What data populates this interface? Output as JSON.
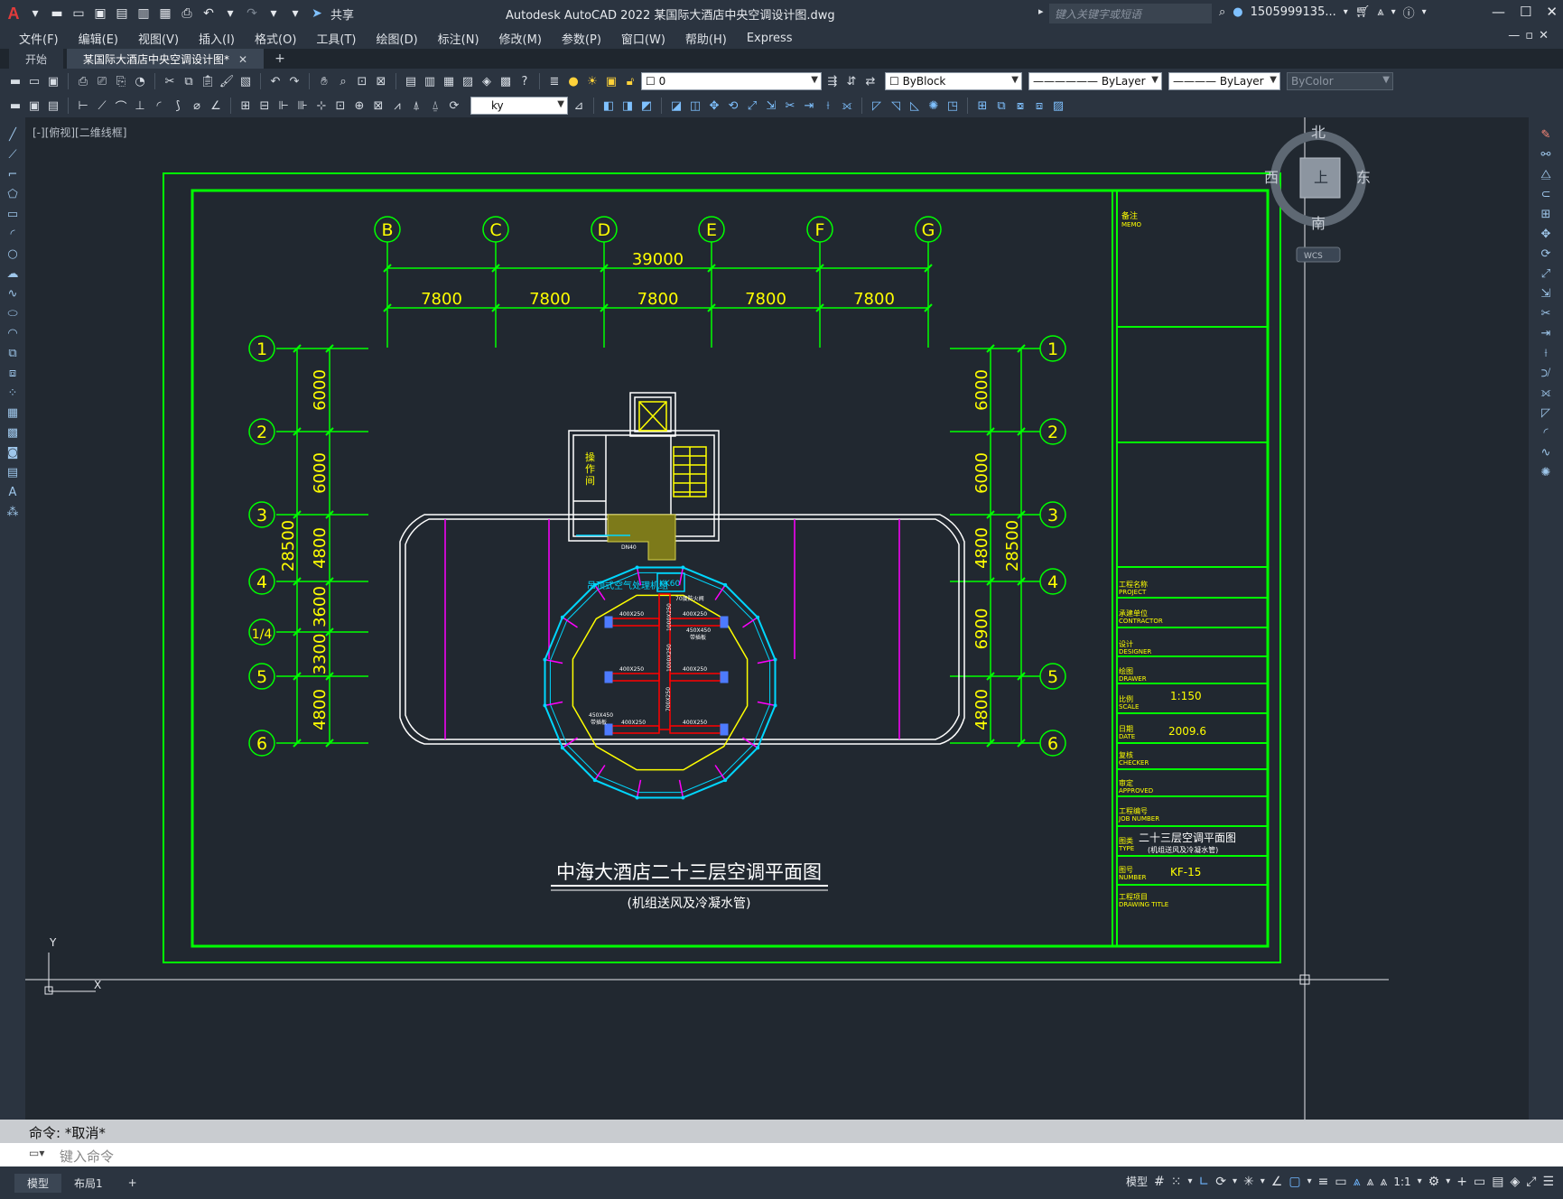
{
  "window": {
    "title": "Autodesk AutoCAD 2022    某国际大酒店中央空调设计图.dwg",
    "search_placeholder": "键入关键字或短语",
    "user": "1505999135...",
    "share_label": "共享"
  },
  "menu": [
    "文件(F)",
    "编辑(E)",
    "视图(V)",
    "插入(I)",
    "格式(O)",
    "工具(T)",
    "绘图(D)",
    "标注(N)",
    "修改(M)",
    "参数(P)",
    "窗口(W)",
    "帮助(H)",
    "Express"
  ],
  "tabs": [
    {
      "label": "开始"
    },
    {
      "label": "某国际大酒店中央空调设计图*"
    }
  ],
  "toolbar": {
    "layer_value": "0",
    "color_value": "ByBlock",
    "linetype_value": "ByLayer",
    "lineweight_value": "ByLayer",
    "plotstyle_value": "ByColor",
    "dimstyle_value": "ky"
  },
  "viewport": {
    "label": "[-][俯视][二维线框]"
  },
  "viewcube": {
    "north": "北",
    "south": "南",
    "east": "东",
    "west": "西",
    "top": "上",
    "wcs": "WCS"
  },
  "ucs": {
    "y": "Y",
    "x": "X"
  },
  "drawing": {
    "col_labels": [
      "B",
      "C",
      "D",
      "E",
      "F",
      "G"
    ],
    "overall_dim": "39000",
    "bay_dims": [
      "7800",
      "7800",
      "7800",
      "7800",
      "7800"
    ],
    "row_labels": [
      "1",
      "2",
      "3",
      "4",
      "1/4",
      "5",
      "6"
    ],
    "row_labels_right": [
      "1",
      "2",
      "3",
      "4",
      "5",
      "6"
    ],
    "left_dims": [
      "6000",
      "6000",
      "4800",
      "3600",
      "3300",
      "4800"
    ],
    "left_total": "28500",
    "right_dims": [
      "6000",
      "6000",
      "4800",
      "6900",
      "4800"
    ],
    "right_total": "28500",
    "title": "中海大酒店二十三层空调平面图",
    "subtitle": "(机组送风及冷凝水管)",
    "room_label": "操\n作\n间",
    "unit_label": "吊顶式空气处理机组",
    "unit_tag": "KK60",
    "duct_labels": [
      "400X250",
      "400X250",
      "400X250",
      "400X250",
      "400X250",
      "400X250",
      "1000X250",
      "1000X250",
      "700X250",
      "450X450",
      "450X450",
      "70度防火阀",
      "带插板",
      "带插板",
      "DN40"
    ]
  },
  "titleblock": {
    "memo": [
      "备注",
      "MEMO"
    ],
    "rows": [
      {
        "cn": "工程名称",
        "en": "PROJECT",
        "value": ""
      },
      {
        "cn": "承建单位",
        "en": "CONTRACTOR",
        "value": ""
      },
      {
        "cn": "设计",
        "en": "DESIGNER",
        "value": ""
      },
      {
        "cn": "绘图",
        "en": "DRAWER",
        "value": ""
      },
      {
        "cn": "比例",
        "en": "SCALE",
        "value": "1:150"
      },
      {
        "cn": "日期",
        "en": "DATE",
        "value": "2009.6"
      },
      {
        "cn": "复核",
        "en": "CHECKER",
        "value": ""
      },
      {
        "cn": "审定",
        "en": "APPROVED",
        "value": ""
      },
      {
        "cn": "工程编号",
        "en": "JOB NUMBER",
        "value": ""
      },
      {
        "cn": "图类",
        "en": "TYPE",
        "value": "二十三层空调平面图",
        "value2": "(机组送风及冷凝水管)"
      },
      {
        "cn": "图号",
        "en": "NUMBER",
        "value": "KF-15"
      },
      {
        "cn": "工程项目",
        "en": "DRAWING TITLE",
        "value": ""
      }
    ]
  },
  "command": {
    "history": "命令:  *取消*",
    "placeholder": "键入命令"
  },
  "status": {
    "layout_tabs": [
      "模型",
      "布局1"
    ],
    "model_label": "模型",
    "scale": "1:1"
  },
  "colors": {
    "frame": "#00ff00",
    "text": "#ffff00",
    "duct": "#ff0000",
    "ring": "#00d7ff",
    "accent": "#ff00ff"
  }
}
